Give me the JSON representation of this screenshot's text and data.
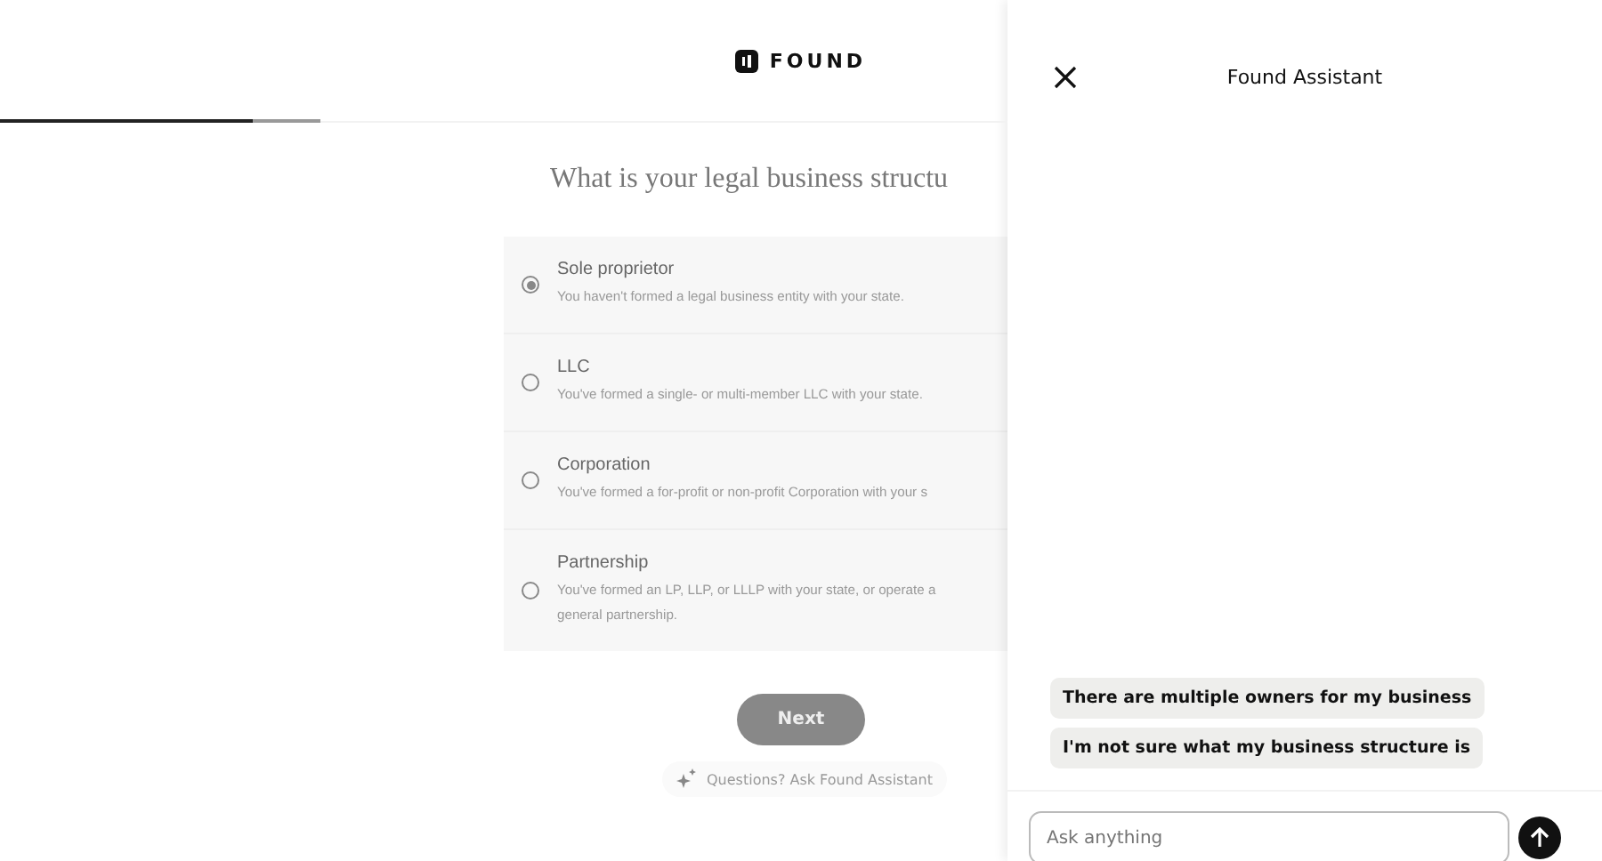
{
  "header": {
    "logo": "FOUND"
  },
  "progress": {
    "level": 0.79
  },
  "question": "What is your legal business structu",
  "options": [
    {
      "label": "Sole proprietor",
      "description": [
        "You haven't formed a legal business entity with your state."
      ],
      "selected": true
    },
    {
      "label": "LLC",
      "description": [
        "You've formed a single- or multi-member LLC with your state."
      ],
      "selected": false
    },
    {
      "label": "Corporation",
      "description": [
        "You've formed a for-profit or non-profit Corporation with your s"
      ],
      "selected": false
    },
    {
      "label": "Partnership",
      "description": [
        "You've formed an LP, LLP, or LLLP with your state, or operate a",
        "general partnership."
      ],
      "selected": false
    }
  ],
  "next_button": "Next",
  "assistant_link": "Questions? Ask Found Assistant",
  "assistant": {
    "title": "Found Assistant",
    "suggestions": [
      "There are multiple owners for my business",
      "I'm not sure what my business structure is"
    ],
    "input": {
      "placeholder": "Ask anything"
    }
  }
}
